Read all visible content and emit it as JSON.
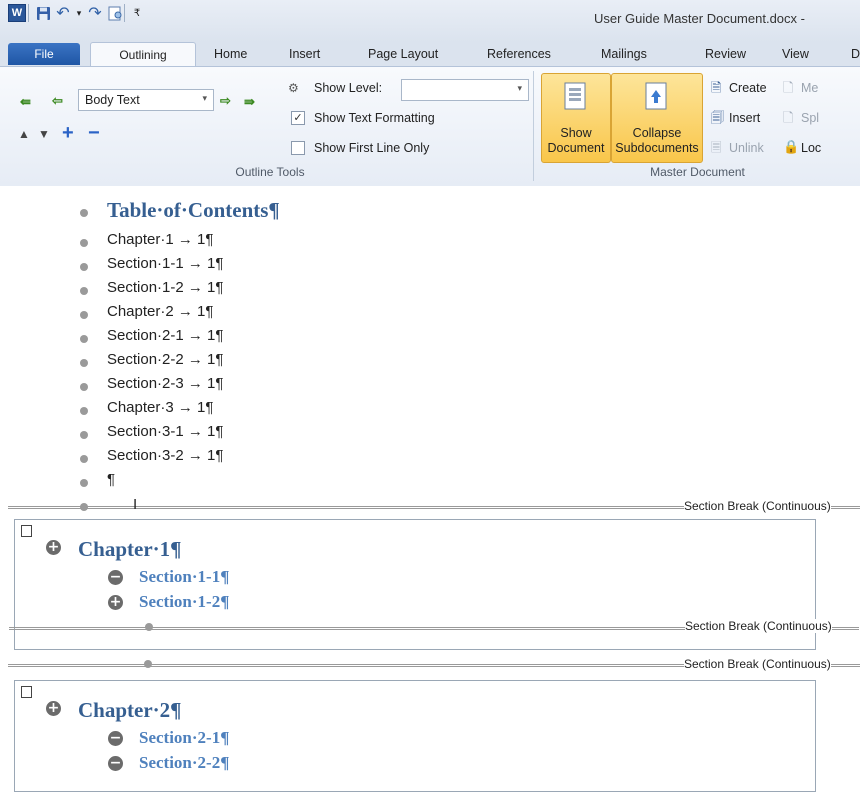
{
  "window": {
    "title": "User Guide Master Document.docx -"
  },
  "qat": {
    "icons": [
      "word-app-icon",
      "save-icon",
      "undo-icon",
      "dropdown-arrow",
      "redo-icon",
      "print-preview-icon",
      "customize-icon"
    ]
  },
  "tabs": {
    "file": "File",
    "outlining": "Outlining",
    "home": "Home",
    "insert": "Insert",
    "page_layout": "Page Layout",
    "references": "References",
    "mailings": "Mailings",
    "review": "Review",
    "view": "View",
    "d": "D"
  },
  "ribbon": {
    "outline_tools": {
      "label": "Outline Tools",
      "level_value": "Body Text",
      "show_level_label": "Show Level:",
      "show_level_value": "",
      "show_text_formatting_label": "Show Text Formatting",
      "show_text_formatting_checked": "✓",
      "show_first_line_only_label": "Show First Line Only"
    },
    "master_document": {
      "label": "Master Document",
      "show_document_line1": "Show",
      "show_document_line2": "Document",
      "collapse_line1": "Collapse",
      "collapse_line2": "Subdocuments",
      "create": "Create",
      "insert": "Insert",
      "unlink": "Unlink",
      "merge": "Me",
      "split": "Spl",
      "lock": "Loc"
    }
  },
  "document": {
    "toc_heading": "Table·of·Contents¶",
    "toc_entries": [
      "Chapter·1 → 1¶",
      "Section·1-1 → 1¶",
      "Section·1-2 → 1¶",
      "Chapter·2 → 1¶",
      "Section·2-1 → 1¶",
      "Section·2-2 → 1¶",
      "Section·2-3 → 1¶",
      "Chapter·3 → 1¶",
      "Section·3-1 → 1¶",
      "Section·3-2 → 1¶",
      "¶"
    ],
    "section_break": "Section Break (Continuous)",
    "subdoc1": {
      "chapter": "Chapter·1¶",
      "sections": [
        "Section·1-1¶",
        "Section·1-2¶"
      ]
    },
    "subdoc2": {
      "chapter": "Chapter·2¶",
      "sections": [
        "Section·2-1¶",
        "Section·2-2¶"
      ]
    }
  },
  "colors": {
    "heading1": "#365f91",
    "heading2": "#4f81bd",
    "file_tab": "#2a5fae",
    "highlight_button": "#f9c64a"
  }
}
